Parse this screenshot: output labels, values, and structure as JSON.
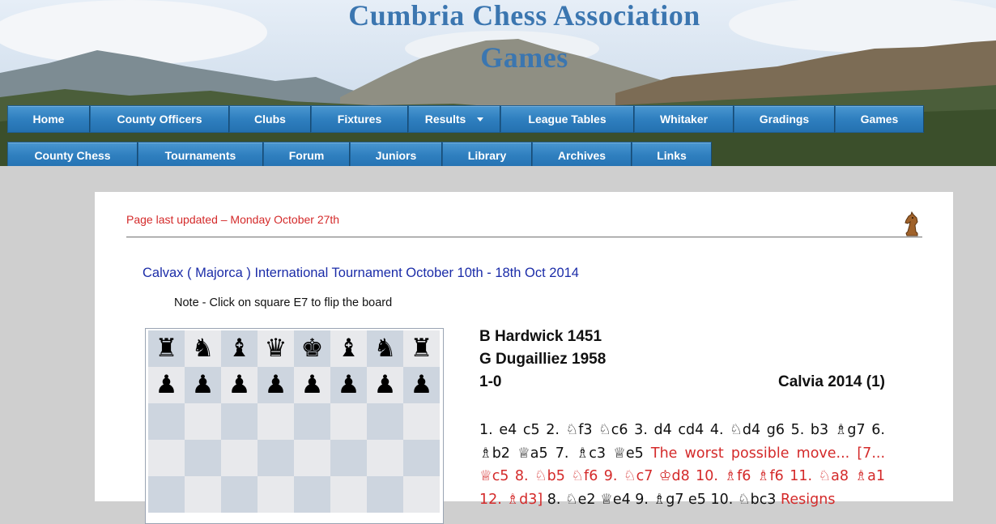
{
  "header": {
    "title_line1": "Cumbria Chess Association",
    "title_line2": "Games"
  },
  "nav_row1": [
    {
      "label": "Home"
    },
    {
      "label": "County Officers"
    },
    {
      "label": "Clubs"
    },
    {
      "label": "Fixtures"
    },
    {
      "label": "Results"
    },
    {
      "label": "League Tables"
    },
    {
      "label": "Whitaker"
    },
    {
      "label": "Gradings"
    },
    {
      "label": "Games"
    }
  ],
  "nav_row2": [
    {
      "label": "County Chess"
    },
    {
      "label": "Tournaments"
    },
    {
      "label": "Forum"
    },
    {
      "label": "Juniors"
    },
    {
      "label": "Library"
    },
    {
      "label": "Archives"
    },
    {
      "label": "Links"
    }
  ],
  "content": {
    "updated_text": "Page last updated – Monday October 27th",
    "tournament_title": "Calvax ( Majorca ) International Tournament October 10th - 18th Oct 2014",
    "note": "Note - Click on square E7 to flip the board"
  },
  "board": {
    "ranks": [
      [
        "♜",
        "♞",
        "♝",
        "♛",
        "♚",
        "♝",
        "♞",
        "♜"
      ],
      [
        "♟",
        "♟",
        "♟",
        "♟",
        "♟",
        "♟",
        "♟",
        "♟"
      ],
      [
        "",
        "",
        "",
        "",
        "",
        "",
        "",
        ""
      ],
      [
        "",
        "",
        "",
        "",
        "",
        "",
        "",
        ""
      ],
      [
        "",
        "",
        "",
        "",
        "",
        "",
        "",
        ""
      ]
    ]
  },
  "game": {
    "white": "B Hardwick 1451",
    "black": "G Dugailliez 1958",
    "result": "1-0",
    "event": "Calvia 2014 (1)",
    "moves_black_text": "1. e4 c5 2. ♘f3 ♘c6 3. d4 cd4 4. ♘d4 g6 5. b3 ♗g7 6. ♗b2 ♕a5 7. ♗c3 ♕e5 ",
    "moves_red_text": "The worst possible move... [7... ♕c5 8. ♘b5 ♘f6 9. ♘c7 ♔d8 10. ♗f6 ♗f6 11. ♘a8 ♗a1 12. ♗d3] ",
    "moves_tail_text": "8. ♘e2 ♕e4 9. ♗g7 e5 10. ♘bc3 ",
    "moves_resign_text": "Resigns"
  },
  "colors": {
    "nav_blue": "#2f7fbf",
    "title_blue": "#3b76b0",
    "red": "#d42a2a",
    "link_blue": "#1b2ca8"
  }
}
